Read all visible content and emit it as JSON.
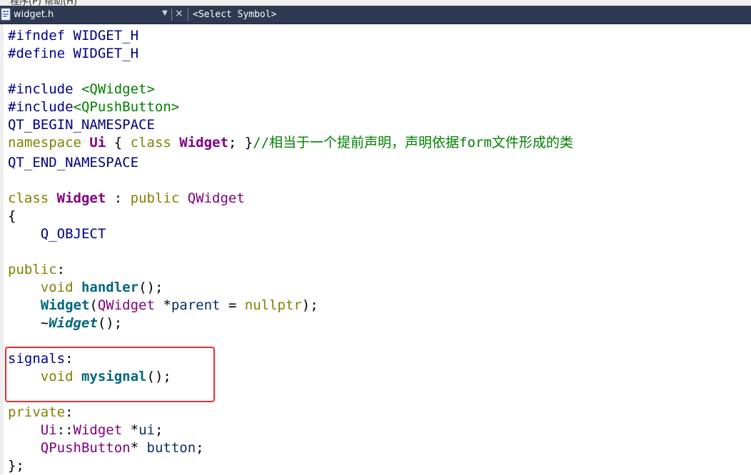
{
  "menu_fragment": "程序(P)   帮助(H)",
  "tab": {
    "file_name": "widget.h",
    "dropdown_glyph": "▼",
    "close_glyph": "×",
    "symbol_selector": "<Select Symbol>",
    "icon": "cpp-header-file-icon"
  },
  "colors": {
    "tab_background": "#2d3a52",
    "highlight_border": "#e62e2e",
    "keyword": "#808000",
    "class_name": "#800080",
    "function_name": "#00677c",
    "preprocessor": "#00008b",
    "include_path": "#008000",
    "comment": "#008000"
  },
  "code": {
    "l1": {
      "a": "#ifndef ",
      "b": "WIDGET_H"
    },
    "l2": {
      "a": "#define ",
      "b": "WIDGET_H"
    },
    "l4": {
      "a": "#include ",
      "b": "<QWidget>"
    },
    "l5": {
      "a": "#include",
      "b": "<QPushButton>"
    },
    "l6": {
      "a": "QT_BEGIN_NAMESPACE"
    },
    "l7": {
      "a": "namespace",
      "b": " ",
      "c": "Ui",
      "d": " { ",
      "e": "class",
      "f": " ",
      "g": "Widget",
      "h": "; }",
      "i": "//相当于一个提前声明，声明依据form文件形成的类"
    },
    "l8": {
      "a": "QT_END_NAMESPACE"
    },
    "l10": {
      "a": "class",
      "b": " ",
      "c": "Widget",
      "d": " : ",
      "e": "public",
      "f": " ",
      "g": "QWidget"
    },
    "l11": {
      "a": "{"
    },
    "l12": {
      "a": "    ",
      "b": "Q_OBJECT"
    },
    "l14": {
      "a": "public",
      "b": ":"
    },
    "l15": {
      "a": "    ",
      "b": "void",
      "c": " ",
      "d": "handler",
      "e": "();"
    },
    "l16": {
      "a": "    ",
      "b": "Widget",
      "c": "(",
      "d": "QWidget",
      "e": " *",
      "f": "parent",
      "g": " = ",
      "h": "nullptr",
      "i": ");"
    },
    "l17": {
      "a": "    ~",
      "b": "Widget",
      "c": "();"
    },
    "l19": {
      "a": "signals",
      "b": ":"
    },
    "l20": {
      "a": "    ",
      "b": "void",
      "c": " ",
      "d": "mysignal",
      "e": "();"
    },
    "l22": {
      "a": "private",
      "b": ":"
    },
    "l23": {
      "a": "    ",
      "b": "Ui",
      "c": "::",
      "d": "Widget",
      "e": " *",
      "f": "ui",
      "g": ";"
    },
    "l24": {
      "a": "    ",
      "b": "QPushButton",
      "c": "* ",
      "d": "button",
      "e": ";"
    },
    "l25": {
      "a": "};"
    }
  }
}
